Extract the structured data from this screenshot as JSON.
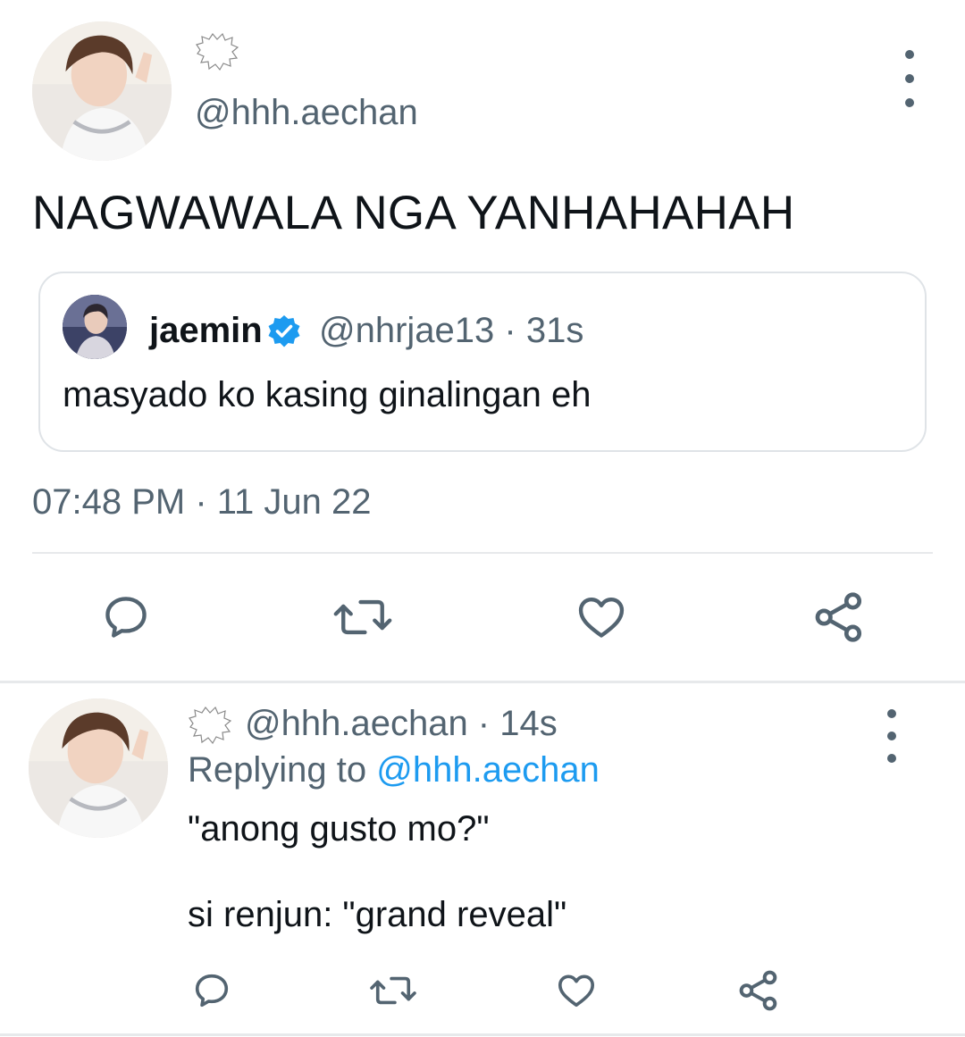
{
  "main_tweet": {
    "handle": "@hhh.aechan",
    "text": "NAGWAWALA NGA YANHAHAHAH",
    "timestamp": "07:48 PM · 11 Jun 22",
    "quoted": {
      "name": "jaemin",
      "handle_time": "@nhrjae13 · 31s",
      "text": "masyado ko kasing ginalingan eh"
    }
  },
  "reply": {
    "handle_time": "@hhh.aechan · 14s",
    "replying_prefix": "Replying to ",
    "replying_mention": "@hhh.aechan",
    "line1": "\"anong gusto mo?\"",
    "line2": "si renjun: \"grand reveal\""
  },
  "colors": {
    "secondary_text": "#536471",
    "link": "#1d9bf0",
    "verified": "#1d9bf0",
    "border": "#dfe3e7"
  },
  "icons": [
    "speech-bubble-badge-icon",
    "more-vertical-icon",
    "reply-icon",
    "retweet-icon",
    "like-icon",
    "share-icon",
    "verified-badge-icon"
  ]
}
